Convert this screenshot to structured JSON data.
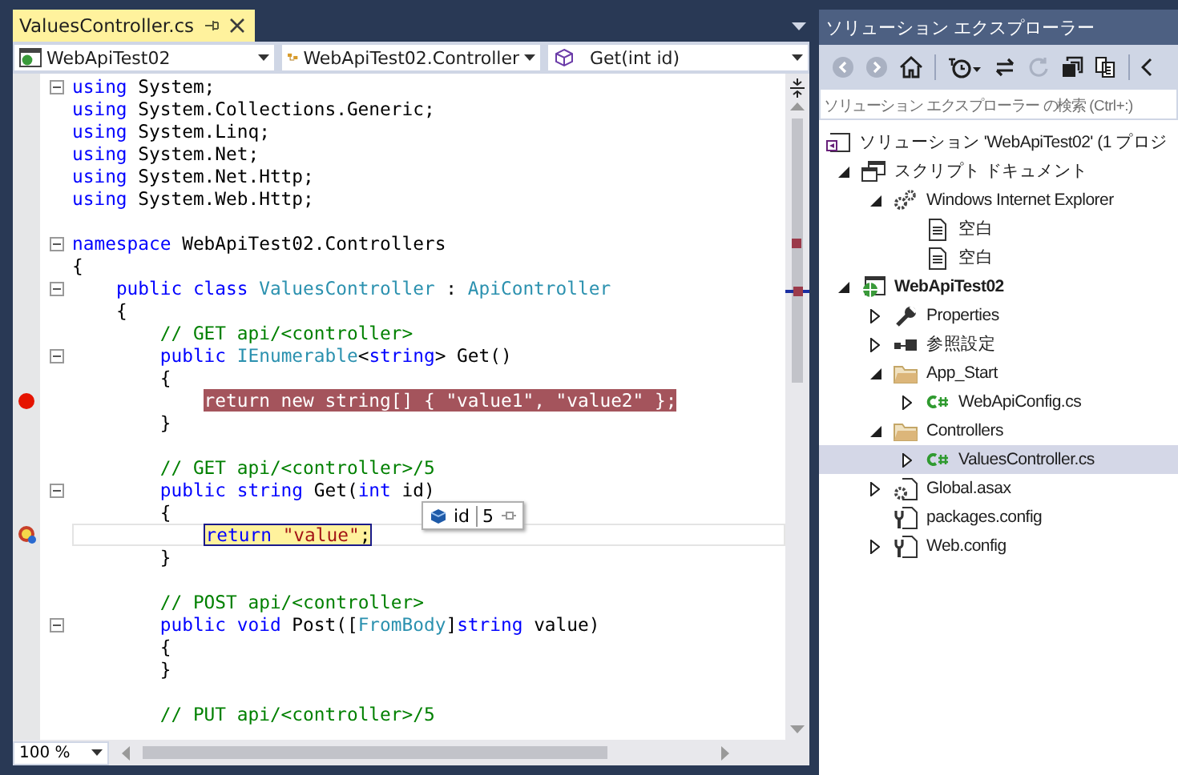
{
  "editor_tab": {
    "title": "ValuesController.cs",
    "selected": true
  },
  "navigation_bar": {
    "project": "WebApiTest02",
    "type": "WebApiTest02.Controller",
    "member": "Get(int id)"
  },
  "code_lines": [
    {
      "kind": "code",
      "fold": true,
      "tokens": [
        {
          "kind": "keyword",
          "text": "using"
        },
        {
          "kind": "plain",
          "text": " System;"
        }
      ]
    },
    {
      "kind": "code",
      "tokens": [
        {
          "kind": "keyword",
          "text": "using"
        },
        {
          "kind": "plain",
          "text": " System.Collections.Generic;"
        }
      ]
    },
    {
      "kind": "code",
      "tokens": [
        {
          "kind": "keyword",
          "text": "using"
        },
        {
          "kind": "plain",
          "text": " System.Linq;"
        }
      ]
    },
    {
      "kind": "code",
      "tokens": [
        {
          "kind": "keyword",
          "text": "using"
        },
        {
          "kind": "plain",
          "text": " System.Net;"
        }
      ]
    },
    {
      "kind": "code",
      "tokens": [
        {
          "kind": "keyword",
          "text": "using"
        },
        {
          "kind": "plain",
          "text": " System.Net.Http;"
        }
      ]
    },
    {
      "kind": "code",
      "tokens": [
        {
          "kind": "keyword",
          "text": "using"
        },
        {
          "kind": "plain",
          "text": " System.Web.Http;"
        }
      ]
    },
    {
      "kind": "blank"
    },
    {
      "kind": "code",
      "fold": true,
      "tokens": [
        {
          "kind": "keyword",
          "text": "namespace"
        },
        {
          "kind": "plain",
          "text": " WebApiTest02.Controllers"
        }
      ]
    },
    {
      "kind": "code",
      "tokens": [
        {
          "kind": "plain",
          "text": "{"
        }
      ]
    },
    {
      "kind": "code",
      "fold": true,
      "tokens": [
        {
          "kind": "keyword",
          "text": "    public class "
        },
        {
          "kind": "type",
          "text": "ValuesController"
        },
        {
          "kind": "plain",
          "text": " : "
        },
        {
          "kind": "type",
          "text": "ApiController"
        }
      ]
    },
    {
      "kind": "code",
      "tokens": [
        {
          "kind": "plain",
          "text": "    {"
        }
      ]
    },
    {
      "kind": "code",
      "tokens": [
        {
          "kind": "comment",
          "text": "        // GET api/<controller>"
        }
      ]
    },
    {
      "kind": "code",
      "fold": true,
      "tokens": [
        {
          "kind": "keyword",
          "text": "        public "
        },
        {
          "kind": "type",
          "text": "IEnumerable"
        },
        {
          "kind": "plain",
          "text": "<"
        },
        {
          "kind": "keyword",
          "text": "string"
        },
        {
          "kind": "plain",
          "text": "> Get()"
        }
      ]
    },
    {
      "kind": "code",
      "tokens": [
        {
          "kind": "plain",
          "text": "        {"
        }
      ]
    },
    {
      "kind": "code",
      "breakpoint": true,
      "tokens": [
        {
          "kind": "keyword",
          "text": "            return new string"
        },
        {
          "kind": "plain",
          "text": "[] { "
        },
        {
          "kind": "string",
          "text": "\"value1\""
        },
        {
          "kind": "plain",
          "text": ", "
        },
        {
          "kind": "string",
          "text": "\"value2\""
        },
        {
          "kind": "plain",
          "text": " };"
        }
      ]
    },
    {
      "kind": "code",
      "tokens": [
        {
          "kind": "plain",
          "text": "        }"
        }
      ]
    },
    {
      "kind": "blank"
    },
    {
      "kind": "code",
      "tokens": [
        {
          "kind": "comment",
          "text": "        // GET api/<controller>/5"
        }
      ]
    },
    {
      "kind": "code",
      "fold": true,
      "tokens": [
        {
          "kind": "keyword",
          "text": "        public string"
        },
        {
          "kind": "plain",
          "text": " Get("
        },
        {
          "kind": "keyword",
          "text": "int"
        },
        {
          "kind": "plain",
          "text": " id)"
        }
      ]
    },
    {
      "kind": "code",
      "tokens": [
        {
          "kind": "plain",
          "text": "        {"
        }
      ]
    },
    {
      "kind": "code",
      "current": true,
      "tokens": [
        {
          "kind": "keyword",
          "text": "            return "
        },
        {
          "kind": "string",
          "text": "\"value\""
        },
        {
          "kind": "plain",
          "text": ";"
        }
      ]
    },
    {
      "kind": "code",
      "tokens": [
        {
          "kind": "plain",
          "text": "        }"
        }
      ]
    },
    {
      "kind": "blank"
    },
    {
      "kind": "code",
      "tokens": [
        {
          "kind": "comment",
          "text": "        // POST api/<controller>"
        }
      ]
    },
    {
      "kind": "code",
      "fold": true,
      "tokens": [
        {
          "kind": "keyword",
          "text": "        public void"
        },
        {
          "kind": "plain",
          "text": " Post(["
        },
        {
          "kind": "type",
          "text": "FromBody"
        },
        {
          "kind": "plain",
          "text": "]"
        },
        {
          "kind": "keyword",
          "text": "string"
        },
        {
          "kind": "plain",
          "text": " value)"
        }
      ]
    },
    {
      "kind": "code",
      "tokens": [
        {
          "kind": "plain",
          "text": "        {"
        }
      ]
    },
    {
      "kind": "code",
      "tokens": [
        {
          "kind": "plain",
          "text": "        }"
        }
      ]
    },
    {
      "kind": "blank"
    },
    {
      "kind": "code",
      "tokens": [
        {
          "kind": "comment",
          "text": "        // PUT api/<controller>/5"
        }
      ]
    }
  ],
  "datatip": {
    "name": "id",
    "value": "5"
  },
  "zoom": "100 %",
  "solution_explorer": {
    "title": "ソリューション エクスプローラー",
    "toolbar": [
      {
        "kind": "back",
        "disabled": true
      },
      {
        "kind": "forward",
        "disabled": true
      },
      {
        "kind": "home",
        "disabled": false
      },
      {
        "kind": "history",
        "disabled": false
      },
      {
        "kind": "sync",
        "disabled": false
      },
      {
        "kind": "refresh",
        "disabled": true
      },
      {
        "kind": "collapse",
        "disabled": false
      },
      {
        "kind": "show-all",
        "disabled": false
      },
      {
        "kind": "more",
        "disabled": false
      }
    ],
    "search": {
      "placeholder": "ソリューション エクスプローラー の検索 (Ctrl+:)"
    },
    "tree": [
      {
        "kind": "solution",
        "label": "ソリューション 'WebApiTest02' (1 プロジ",
        "selected": false,
        "children": [
          {
            "kind": "script-group",
            "label": "スクリプト ドキュメント",
            "expanded": true,
            "selected": false,
            "children": [
              {
                "kind": "browser",
                "label": "Windows Internet Explorer",
                "expanded": true,
                "selected": false,
                "children": [
                  {
                    "kind": "document",
                    "label": "空白",
                    "selected": false
                  },
                  {
                    "kind": "document",
                    "label": "空白",
                    "selected": false
                  }
                ]
              }
            ]
          },
          {
            "kind": "project",
            "label": "WebApiTest02",
            "expanded": true,
            "selected": false,
            "children": [
              {
                "kind": "properties",
                "label": "Properties",
                "expanded": false,
                "selected": false
              },
              {
                "kind": "references",
                "label": "参照設定",
                "expanded": false,
                "selected": false
              },
              {
                "kind": "folder",
                "label": "App_Start",
                "expanded": true,
                "selected": false,
                "children": [
                  {
                    "kind": "csharp-file",
                    "label": "WebApiConfig.cs",
                    "expanded": false,
                    "selected": false
                  }
                ]
              },
              {
                "kind": "folder",
                "label": "Controllers",
                "expanded": true,
                "selected": false,
                "children": [
                  {
                    "kind": "csharp-file",
                    "label": "ValuesController.cs",
                    "expanded": false,
                    "selected": true
                  }
                ]
              },
              {
                "kind": "asax-file",
                "label": "Global.asax",
                "expanded": false,
                "selected": false
              },
              {
                "kind": "config-file",
                "label": "packages.config",
                "selected": false
              },
              {
                "kind": "config-file",
                "label": "Web.config",
                "expanded": false,
                "selected": false
              }
            ]
          }
        ]
      }
    ]
  }
}
